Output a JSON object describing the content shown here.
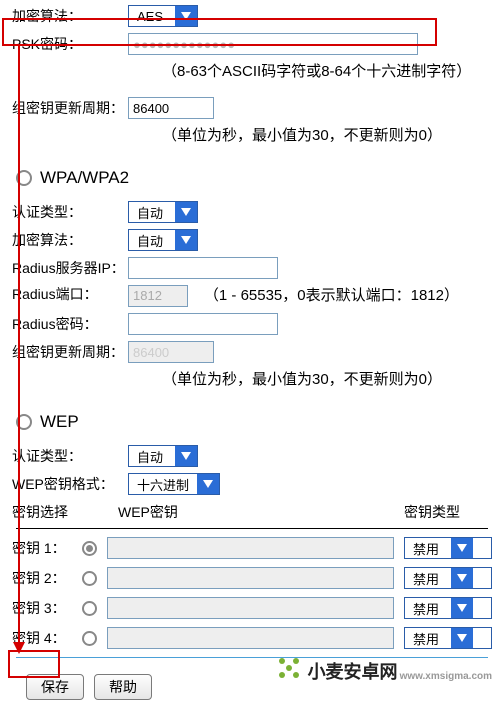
{
  "top": {
    "ciphers_label": "加密算法：",
    "ciphers_value": "AES",
    "psk_label": "PSK密码：",
    "psk_value": "●●●●●●●●●●●●●",
    "psk_hint": "（8-63个ASCII码字符或8-64个十六进制字符）",
    "group_key_label": "组密钥更新周期：",
    "group_key_value": "86400",
    "group_key_hint": "（单位为秒，最小值为30，不更新则为0）"
  },
  "wpa": {
    "title": "WPA/WPA2",
    "auth_label": "认证类型：",
    "auth_value": "自动",
    "cipher_label": "加密算法：",
    "cipher_value": "自动",
    "radius_ip_label": "Radius服务器IP：",
    "radius_ip_value": "",
    "radius_port_label": "Radius端口：",
    "radius_port_value": "1812",
    "radius_port_hint": "（1 - 65535，0表示默认端口：1812）",
    "radius_pwd_label": "Radius密码：",
    "radius_pwd_value": "",
    "group_key_label": "组密钥更新周期：",
    "group_key_value": "86400",
    "group_key_hint": "（单位为秒，最小值为30，不更新则为0）"
  },
  "wep": {
    "title": "WEP",
    "auth_label": "认证类型：",
    "auth_value": "自动",
    "fmt_label": "WEP密钥格式：",
    "fmt_value": "十六进制",
    "header_select": "密钥选择",
    "header_key": "WEP密钥",
    "header_type": "密钥类型",
    "key1_label": "密钥 1：",
    "key2_label": "密钥 2：",
    "key3_label": "密钥 3：",
    "key4_label": "密钥 4：",
    "disabled_value": "禁用"
  },
  "buttons": {
    "save": "保存",
    "help": "帮助"
  },
  "watermark": {
    "name": "小麦安卓网",
    "sub": "www.xmsigma.com"
  }
}
